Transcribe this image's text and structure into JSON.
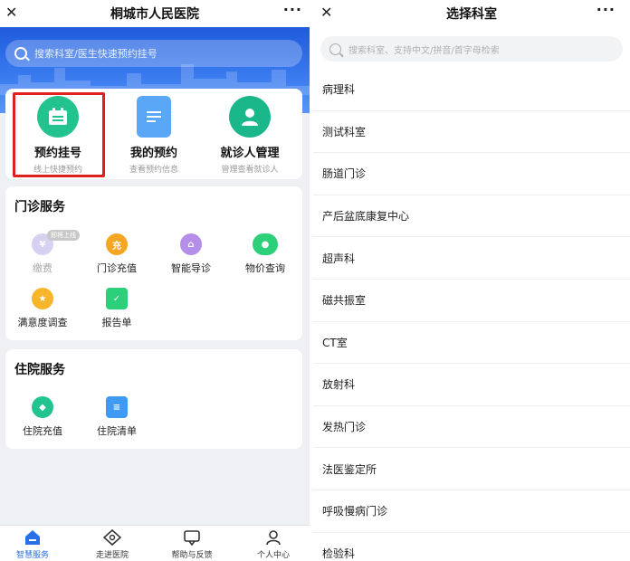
{
  "left": {
    "title": "桐城市人民医院",
    "search_placeholder": "搜索科室/医生快速预约挂号",
    "quick_actions": [
      {
        "label": "预约挂号",
        "sub": "线上快捷预约",
        "icon": "calendar-icon",
        "color": "#22c38e"
      },
      {
        "label": "我的预约",
        "sub": "查看预约信息",
        "icon": "document-icon",
        "color": "#5aa6f7"
      },
      {
        "label": "就诊人管理",
        "sub": "管理查看就诊人",
        "icon": "person-icon",
        "color": "#19b78a"
      }
    ],
    "outpatient": {
      "title": "门诊服务",
      "badge": "即将上线",
      "items": [
        {
          "label": "缴费",
          "glyph": "¥",
          "color": "#d8d0f0",
          "dim": true
        },
        {
          "label": "门诊充值",
          "glyph": "充",
          "color": "#f5a623"
        },
        {
          "label": "智能导诊",
          "glyph": "⌂",
          "color": "#b48ee8"
        },
        {
          "label": "物价查询",
          "glyph": "●",
          "color": "#2ccf7a"
        },
        {
          "label": "满意度调查",
          "glyph": "★",
          "color": "#f7b52c"
        },
        {
          "label": "报告单",
          "glyph": "✓",
          "color": "#2ccf7a"
        }
      ]
    },
    "inpatient": {
      "title": "住院服务",
      "items": [
        {
          "label": "住院充值",
          "glyph": "◆",
          "color": "#22c38e"
        },
        {
          "label": "住院清单",
          "glyph": "≡",
          "color": "#3f9af5"
        }
      ]
    },
    "tabs": [
      {
        "label": "智慧服务",
        "icon": "home-icon",
        "active": true
      },
      {
        "label": "走进医院",
        "icon": "compass-icon",
        "active": false
      },
      {
        "label": "帮助与反馈",
        "icon": "chat-icon",
        "active": false
      },
      {
        "label": "个人中心",
        "icon": "user-icon",
        "active": false
      }
    ]
  },
  "right": {
    "title": "选择科室",
    "search_placeholder": "搜索科室、支持中文/拼音/首字母检索",
    "departments": [
      "病理科",
      "测试科室",
      "肠道门诊",
      "产后盆底康复中心",
      "超声科",
      "磁共振室",
      "CT室",
      "放射科",
      "发热门诊",
      "法医鉴定所",
      "呼吸慢病门诊",
      "检验科"
    ]
  },
  "colors": {
    "brand": "#2a6fe8",
    "highlight": "#e02020"
  }
}
